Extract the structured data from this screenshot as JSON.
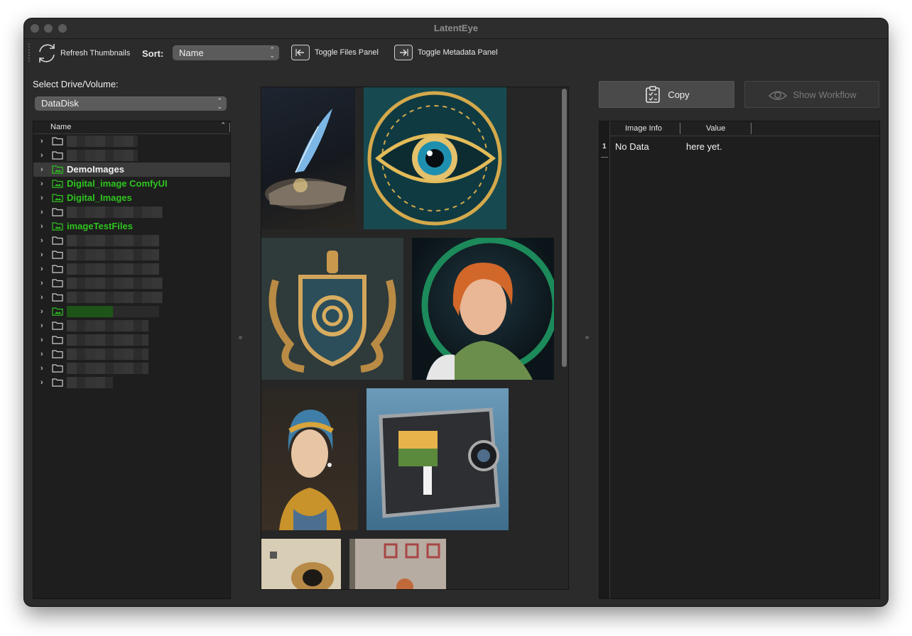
{
  "window": {
    "title": "LatentEye"
  },
  "toolbar": {
    "refresh_label": "Refresh Thumbnails",
    "sort_label": "Sort:",
    "sort_value": "Name",
    "toggle_files_label": "Toggle Files Panel",
    "toggle_metadata_label": "Toggle Metadata Panel"
  },
  "files": {
    "drive_label": "Select Drive/Volume:",
    "drive_value": "DataDisk",
    "column_header": "Name",
    "named_folders": [
      "DemoImages",
      "Digital_image ComfyUI",
      "Digital_Images",
      "imageTestFiles"
    ],
    "selected_folder": "DemoImages"
  },
  "metadata": {
    "copy_label": "Copy",
    "show_workflow_label": "Show Workflow",
    "col_image_info": "Image Info",
    "col_value": "Value",
    "row_number": "1",
    "row_info": "No Data",
    "row_value": "here yet."
  },
  "colors": {
    "accent_green": "#2ec41e",
    "window_bg": "#2b2b2b",
    "panel_bg": "#1e1e1e"
  }
}
